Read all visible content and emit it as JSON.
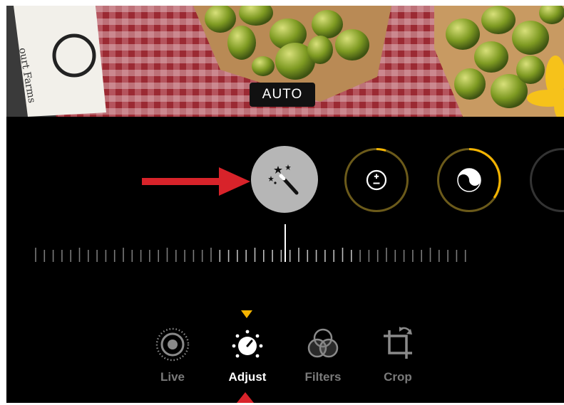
{
  "photo": {
    "badge": "AUTO"
  },
  "tools": [
    {
      "id": "auto",
      "icon": "magic-wand-icon",
      "selected": true
    },
    {
      "id": "exposure",
      "icon": "plus-minus-icon",
      "level": 0.05
    },
    {
      "id": "brilliance",
      "icon": "yin-yang-icon",
      "level": 0.4
    },
    {
      "id": "next",
      "icon": "partial-circle-icon"
    }
  ],
  "tabs": [
    {
      "label": "Live",
      "icon": "live-photo-icon",
      "active": false
    },
    {
      "label": "Adjust",
      "icon": "adjust-dial-icon",
      "active": true
    },
    {
      "label": "Filters",
      "icon": "filters-icon",
      "active": false
    },
    {
      "label": "Crop",
      "icon": "crop-icon",
      "active": false
    }
  ],
  "colors": {
    "accent": "#f5b400",
    "annotation": "#d8232a",
    "selected_tool": "#b6b6b6"
  }
}
